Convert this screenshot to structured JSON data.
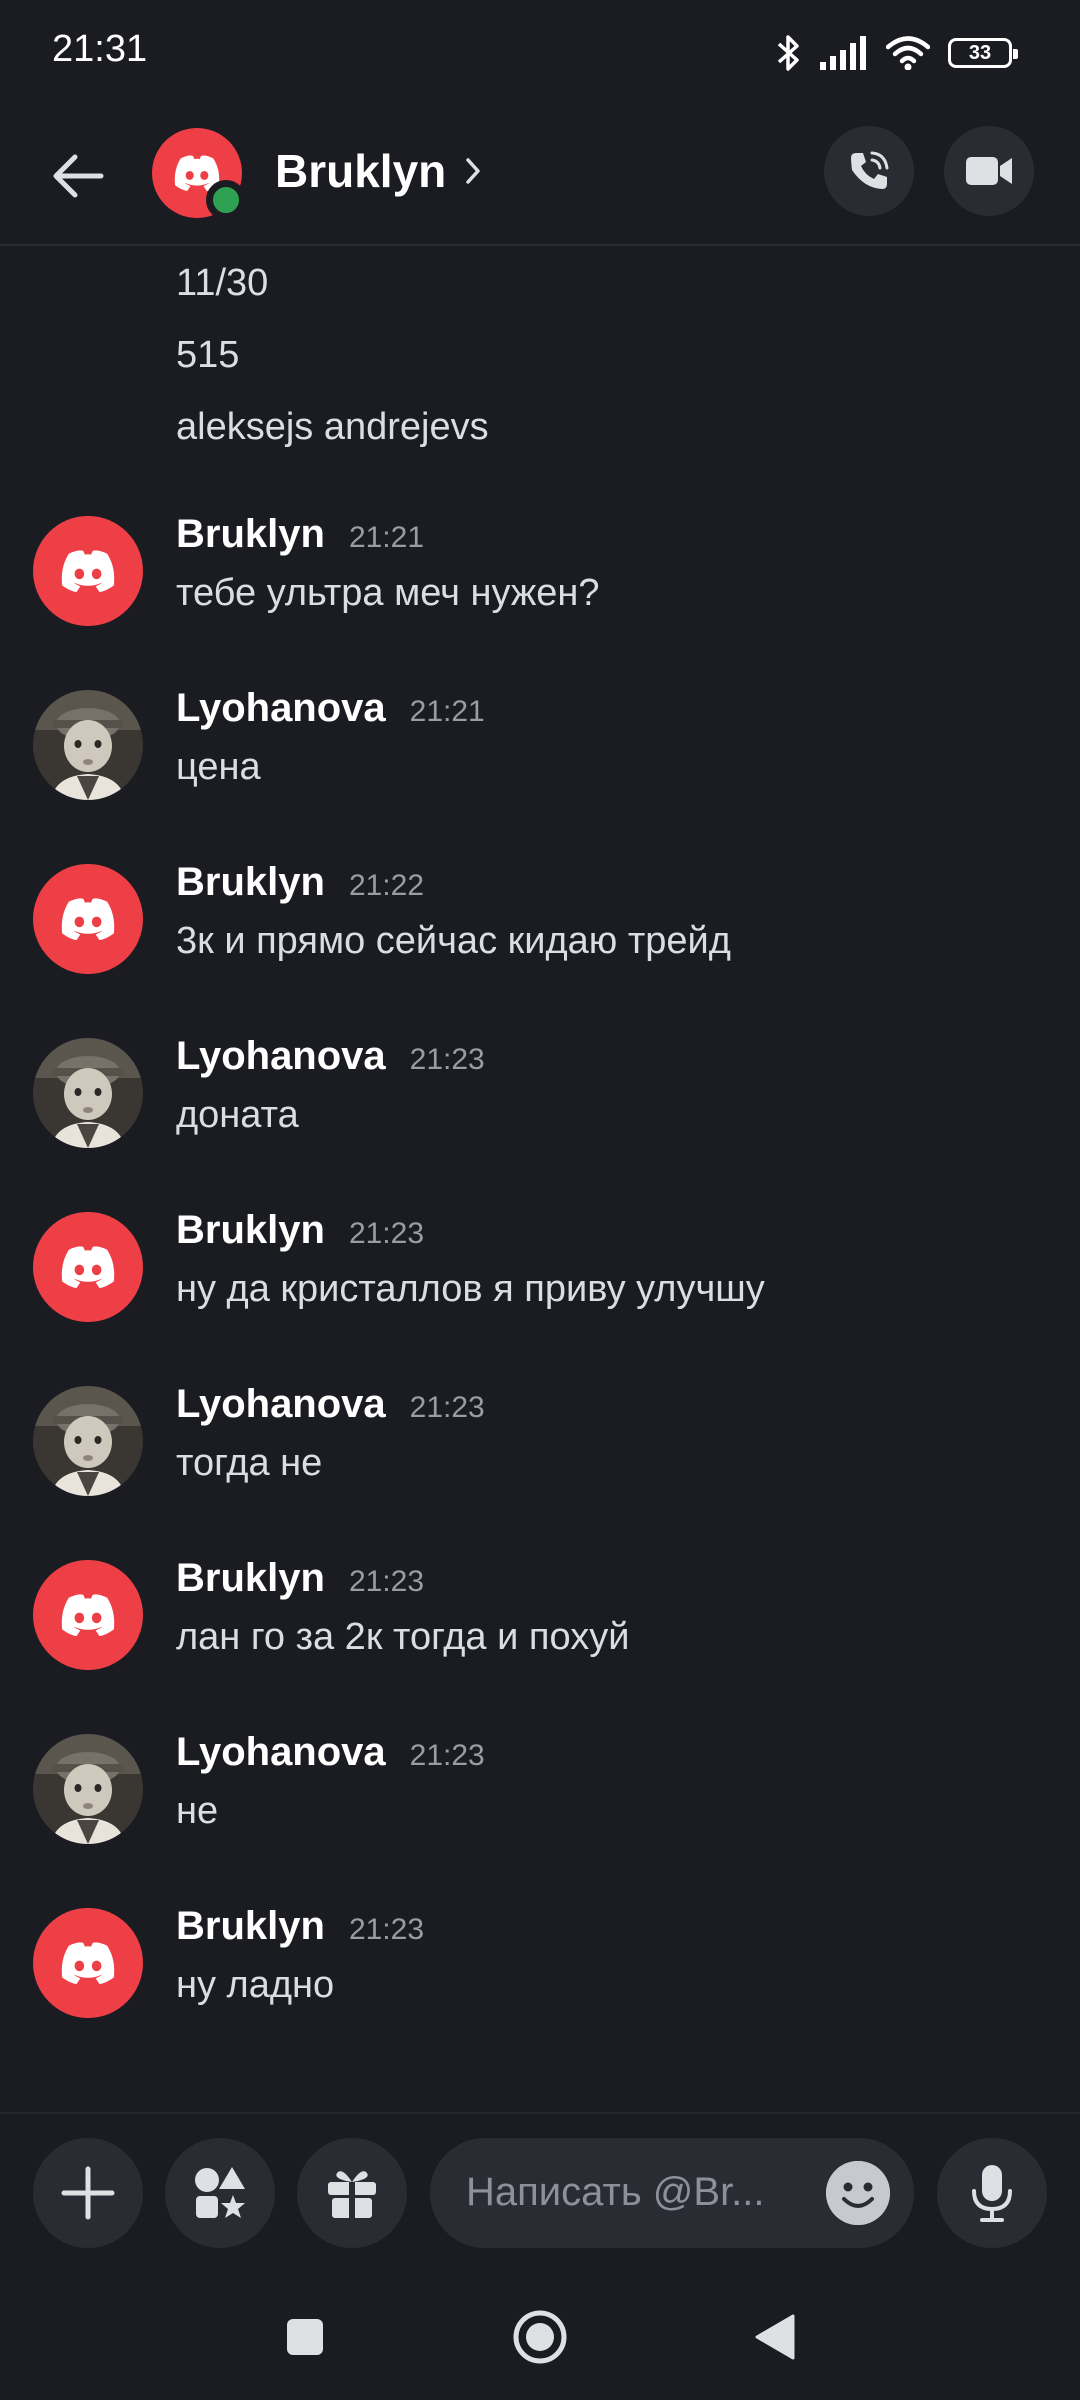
{
  "status_bar": {
    "time": "21:31",
    "battery": "33",
    "icons": [
      "bluetooth-icon",
      "signal-icon",
      "wifi-icon",
      "battery-icon"
    ]
  },
  "header": {
    "contact_name": "Bruklyn",
    "status": "online",
    "icons": [
      "back-arrow-icon",
      "chevron-right-icon",
      "phone-icon",
      "video-icon"
    ]
  },
  "messages": {
    "continued_lines": [
      "11/30",
      "515",
      "aleksejs andrejevs"
    ],
    "items": [
      {
        "author": "Bruklyn",
        "time": "21:21",
        "text": "тебе ультра меч нужен?"
      },
      {
        "author": "Lyohanova",
        "time": "21:21",
        "text": "цена"
      },
      {
        "author": "Bruklyn",
        "time": "21:22",
        "text": "3к и прямо сейчас кидаю трейд"
      },
      {
        "author": "Lyohanova",
        "time": "21:23",
        "text": "доната"
      },
      {
        "author": "Bruklyn",
        "time": "21:23",
        "text": "ну да кристаллов я приву улучшу"
      },
      {
        "author": "Lyohanova",
        "time": "21:23",
        "text": "тогда не"
      },
      {
        "author": "Bruklyn",
        "time": "21:23",
        "text": "лан го за 2к тогда и похуй"
      },
      {
        "author": "Lyohanova",
        "time": "21:23",
        "text": "не"
      },
      {
        "author": "Bruklyn",
        "time": "21:23",
        "text": "ну ладно"
      }
    ]
  },
  "composer": {
    "placeholder": "Написать @Br...",
    "icons": [
      "plus-icon",
      "apps-icon",
      "gift-icon",
      "emoji-icon",
      "microphone-icon"
    ]
  },
  "nav_bar": {
    "icons": [
      "recents-square-icon",
      "home-circle-icon",
      "back-triangle-icon"
    ]
  },
  "colors": {
    "background": "#1b1c22",
    "discord_red": "#ef3f46",
    "online_green": "#2fa152",
    "button_bg": "#2a2c33"
  }
}
